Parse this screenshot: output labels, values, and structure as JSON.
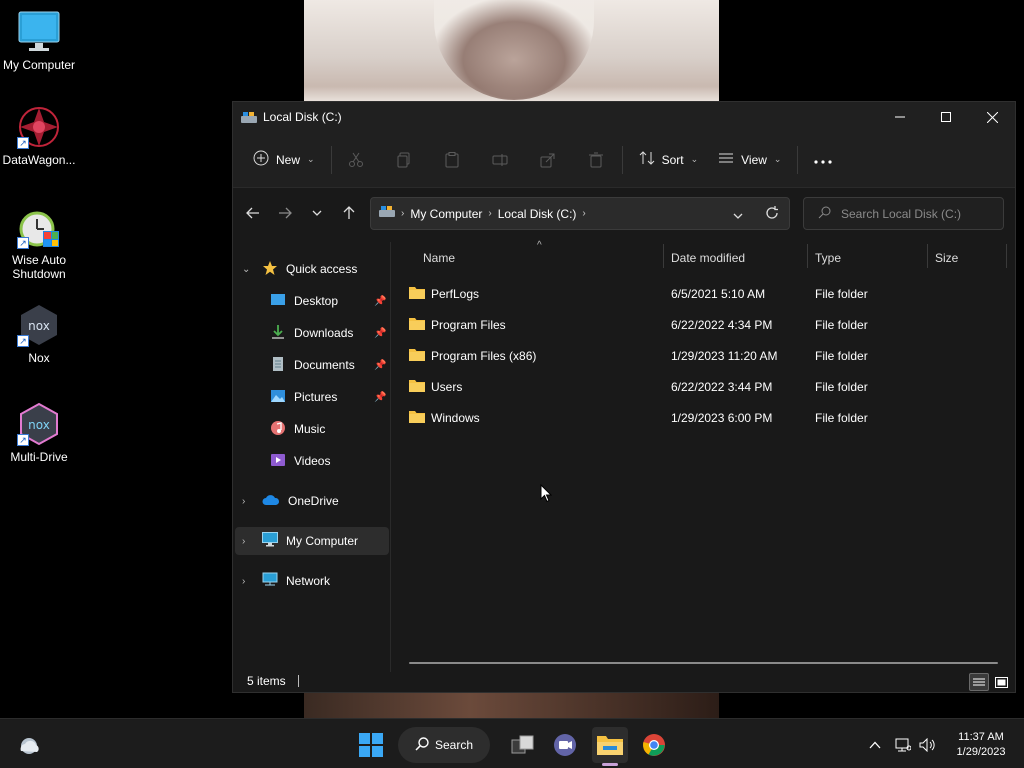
{
  "desktop": {
    "icons": [
      {
        "label": "My Computer",
        "icon": "monitor-icon"
      },
      {
        "label": "DataWagon...",
        "icon": "datawagon-icon"
      },
      {
        "label": "Wise Auto Shutdown",
        "icon": "alarm-clock-icon"
      },
      {
        "label": "Nox",
        "icon": "nox-icon"
      },
      {
        "label": "Multi-Drive",
        "icon": "multi-drive-icon"
      }
    ]
  },
  "window": {
    "title": "Local Disk (C:)",
    "commands": {
      "new": "New",
      "sort": "Sort",
      "view": "View"
    },
    "breadcrumb": [
      "My Computer",
      "Local Disk (C:)"
    ],
    "search_placeholder": "Search Local Disk (C:)",
    "sidebar": {
      "quick_access": "Quick access",
      "quick_items": [
        {
          "label": "Desktop",
          "pinned": true
        },
        {
          "label": "Downloads",
          "pinned": true
        },
        {
          "label": "Documents",
          "pinned": true
        },
        {
          "label": "Pictures",
          "pinned": true
        },
        {
          "label": "Music",
          "pinned": false
        },
        {
          "label": "Videos",
          "pinned": false
        }
      ],
      "onedrive": "OneDrive",
      "my_computer": "My Computer",
      "network": "Network"
    },
    "columns": {
      "name": "Name",
      "date": "Date modified",
      "type": "Type",
      "size": "Size"
    },
    "files": [
      {
        "name": "PerfLogs",
        "date": "6/5/2021 5:10 AM",
        "type": "File folder"
      },
      {
        "name": "Program Files",
        "date": "6/22/2022 4:34 PM",
        "type": "File folder"
      },
      {
        "name": "Program Files (x86)",
        "date": "1/29/2023 11:20 AM",
        "type": "File folder"
      },
      {
        "name": "Users",
        "date": "6/22/2022 3:44 PM",
        "type": "File folder"
      },
      {
        "name": "Windows",
        "date": "1/29/2023 6:00 PM",
        "type": "File folder"
      }
    ],
    "status": "5 items"
  },
  "taskbar": {
    "search_label": "Search",
    "time": "11:37 AM",
    "date": "1/29/2023"
  },
  "colors": {
    "folder": "#f5c142",
    "accent": "#0078d4",
    "window_bg": "#191919"
  }
}
